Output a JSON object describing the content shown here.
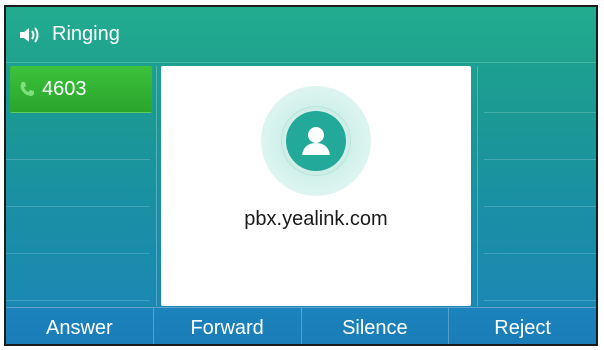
{
  "status_bar": {
    "icon": "speaker-icon",
    "label": "Ringing"
  },
  "line_keys_left": [
    {
      "label": "4603",
      "icon": "phone-icon",
      "active": true
    },
    {
      "label": ""
    },
    {
      "label": ""
    },
    {
      "label": ""
    },
    {
      "label": ""
    }
  ],
  "line_keys_right": [
    {
      "label": ""
    },
    {
      "label": ""
    },
    {
      "label": ""
    },
    {
      "label": ""
    },
    {
      "label": ""
    }
  ],
  "caller": {
    "avatar_icon": "contact-avatar-icon",
    "name": "pbx.yealink.com"
  },
  "softkeys": [
    {
      "label": "Answer"
    },
    {
      "label": "Forward"
    },
    {
      "label": "Silence"
    },
    {
      "label": "Reject"
    }
  ],
  "colors": {
    "accent_green": "#2aa52b",
    "avatar_teal": "#22a99a",
    "softkey_blue": "#1c83bd"
  }
}
